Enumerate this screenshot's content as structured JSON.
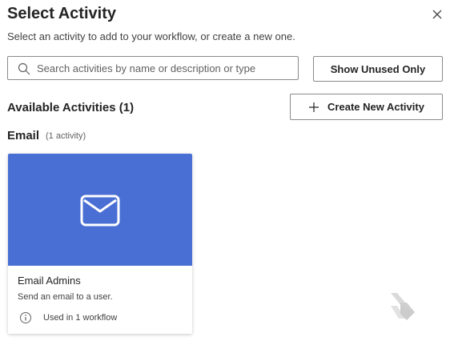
{
  "dialog": {
    "title": "Select Activity",
    "subtitle": "Select an activity to add to your workflow, or create a new one.",
    "close_icon": "close-icon"
  },
  "search": {
    "placeholder": "Search activities by name or description or type",
    "value": "",
    "icon": "search-icon"
  },
  "buttons": {
    "show_unused": "Show Unused Only",
    "create_new": "Create New Activity"
  },
  "available": {
    "heading": "Available Activities (1)"
  },
  "groups": [
    {
      "name": "Email",
      "count_label": "(1 activity)",
      "activities": [
        {
          "name": "Email Admins",
          "description": "Send an email to a user.",
          "usage": "Used in 1 workflow",
          "icon": "envelope-icon",
          "tile_color": "#4a6fd4"
        }
      ]
    }
  ],
  "colors": {
    "accent": "#4a6fd4",
    "logo": "#e0e0e0"
  }
}
